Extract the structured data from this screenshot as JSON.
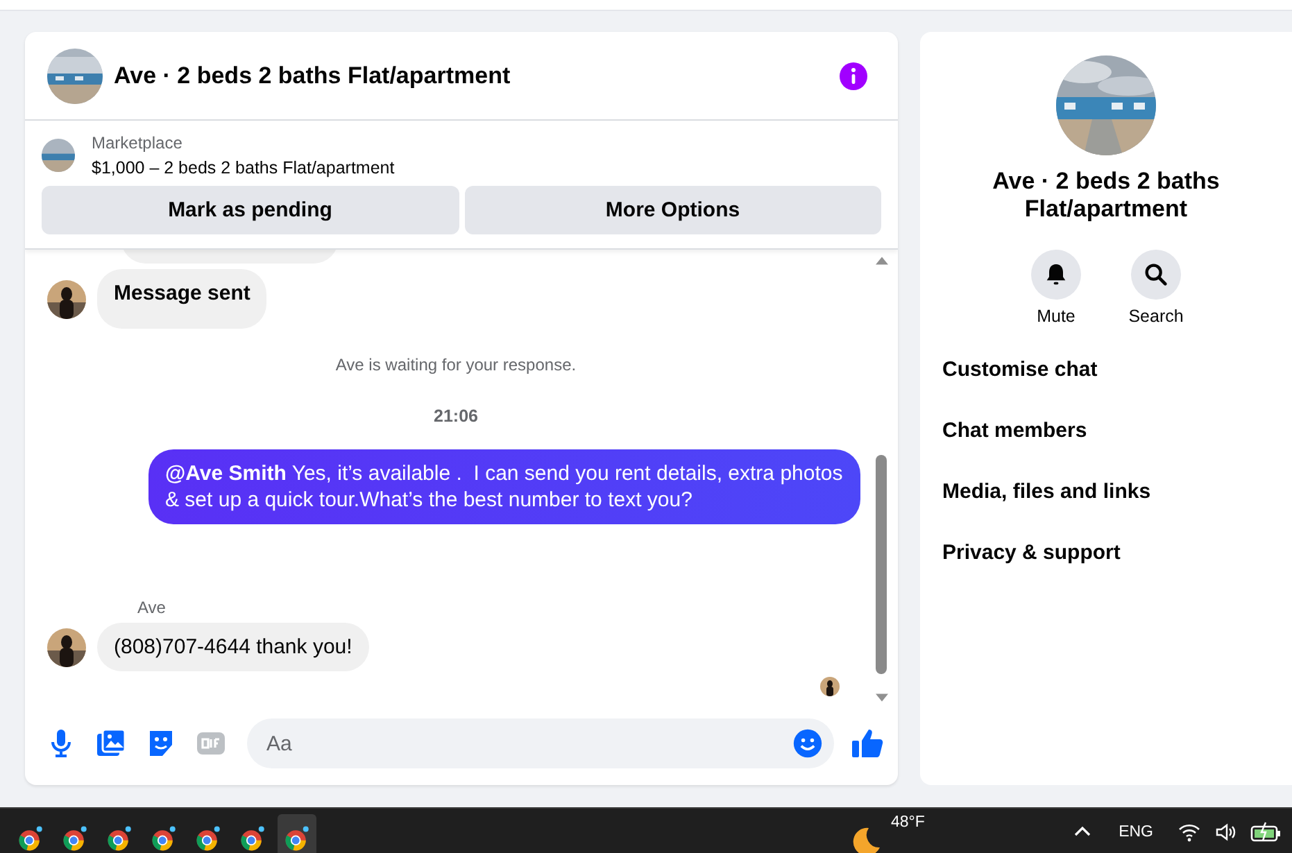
{
  "header": {
    "title": "Ave · 2 beds 2 baths Flat/apartment"
  },
  "listing": {
    "label": "Marketplace",
    "summary": "$1,000 – 2 beds 2 baths Flat/apartment",
    "actions": [
      "Mark as pending",
      "More Options"
    ]
  },
  "messages": [
    {
      "kind": "clipped"
    },
    {
      "kind": "incoming",
      "text": "Message sent"
    },
    {
      "kind": "notice",
      "text": "Ave is waiting for your response."
    },
    {
      "kind": "time",
      "text": "21:06"
    },
    {
      "kind": "outgoing",
      "text": "**@Ave Smith** Yes, it’s available .  I can send you rent details, extra photos & set up a quick tour.What’s the best number to text you?"
    },
    {
      "kind": "incoming",
      "sender": "Ave",
      "text": "(808)707-4644 thank you!"
    }
  ],
  "composer": {
    "placeholder": "Aa"
  },
  "details": {
    "title": "Ave · 2 beds 2 baths Flat/apartment",
    "actions": [
      {
        "kind": "bell",
        "label": "Mute"
      },
      {
        "kind": "search",
        "label": "Search"
      }
    ],
    "menu": [
      "Customise chat",
      "Chat members",
      "Media, files and links",
      "Privacy & support"
    ]
  },
  "taskbar": {
    "apps": [
      {
        "selected": false
      },
      {
        "selected": false
      },
      {
        "selected": false
      },
      {
        "selected": false
      },
      {
        "selected": false
      },
      {
        "selected": false
      },
      {
        "selected": true
      }
    ],
    "weather": "48°F",
    "language": "ENG"
  }
}
